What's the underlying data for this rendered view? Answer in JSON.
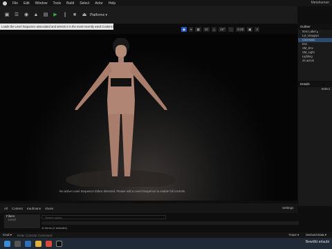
{
  "menu": {
    "items": [
      "File",
      "Edit",
      "Window",
      "Tools",
      "Build",
      "Select",
      "Actor",
      "Help"
    ],
    "project": "Metahuman"
  },
  "toolbar": {
    "platforms": "Platforms ▾"
  },
  "tooltip": "Loads the Level Sequence associated and selects it in the most recently used Content Browser (summoning one if necessary)",
  "viewport": {
    "chips": [
      "◉",
      "⌖",
      "▦",
      "10",
      "△",
      "10°",
      "⬚",
      "0.25",
      "▣",
      "4"
    ],
    "sequencer_message": "No active Level Sequence Editor detected. Please edit a Level Sequence to enable full controls."
  },
  "outliner": {
    "title": "Outliner",
    "rows": [
      "Item Label ▴",
      "Lvl_Viewport",
      "Cinematic",
      "Env",
      "SM_Env",
      "SM_Light",
      "Lighting"
    ],
    "count": "25 actors"
  },
  "details": {
    "title": "Details",
    "body": "Select"
  },
  "content": {
    "crumbs": [
      "All",
      "Content",
      "Kaufmann",
      "shoes"
    ],
    "settings": "Settings",
    "filters_title": "Filters",
    "filters_item": "Level",
    "search_placeholder": "Search shoes",
    "item_count": "11 items (1 selected)"
  },
  "status": {
    "console": "Cmd ▾",
    "console_placeholder": "Enter Console Command",
    "trace": "Trace ▾",
    "derived": "Derived Data ▾"
  },
  "taskbar": {
    "weather": "Bewölkt erlaubt"
  }
}
